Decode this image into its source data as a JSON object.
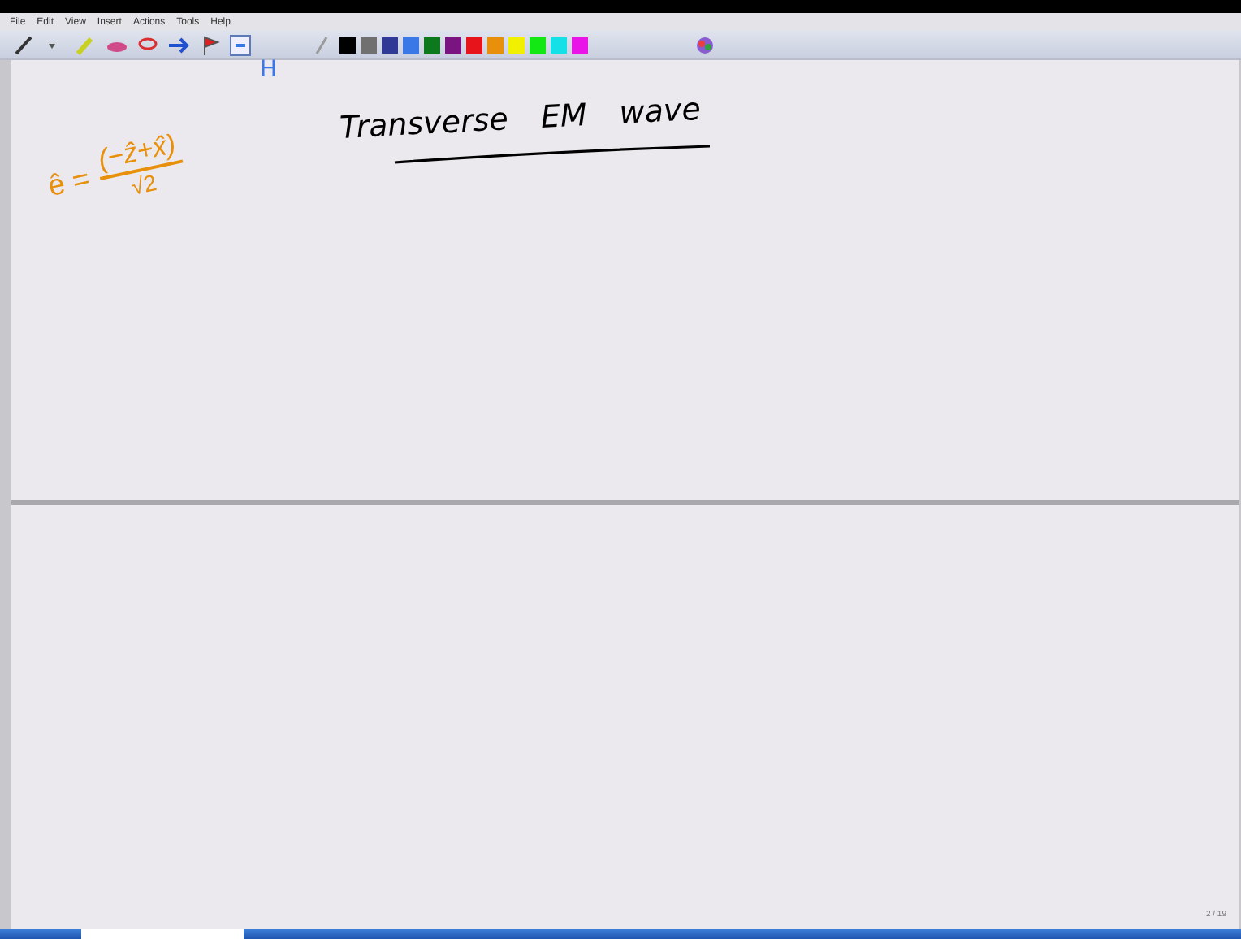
{
  "menu": [
    "File",
    "Edit",
    "View",
    "Insert",
    "Actions",
    "Tools",
    "Help"
  ],
  "palette": [
    {
      "color": "#000000"
    },
    {
      "color": "#707070"
    },
    {
      "color": "#2e3a96"
    },
    {
      "color": "#3a78e8"
    },
    {
      "color": "#0c7a1c"
    },
    {
      "color": "#7a1480"
    },
    {
      "color": "#e8141c"
    },
    {
      "color": "#e8900c"
    },
    {
      "color": "#f0f000"
    },
    {
      "color": "#14e814"
    },
    {
      "color": "#14e0e8"
    },
    {
      "color": "#e814e8"
    }
  ],
  "ink": [
    {
      "kind": "text",
      "text": "H",
      "color": "#3a78e8"
    },
    {
      "kind": "equation",
      "lhs": "ê =",
      "numerator": "(−ẑ+x̂)",
      "denominator": "√2",
      "color": "#e8900c"
    },
    {
      "kind": "heading",
      "text": "Transverse EM wave",
      "color": "#000000"
    }
  ],
  "page_number": "2 / 19"
}
